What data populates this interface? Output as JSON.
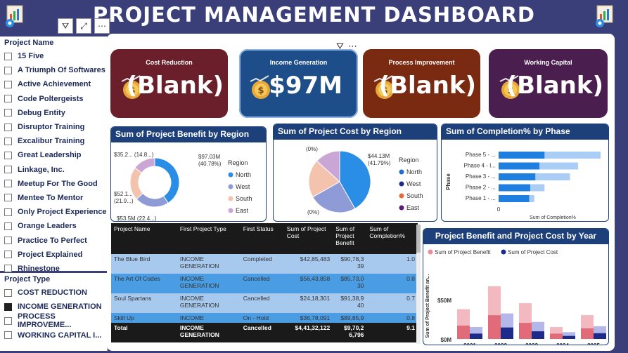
{
  "title": "PROJECT MANAGEMENT DASHBOARD",
  "project_name_slicer": {
    "header": "Project Name",
    "items": [
      "15 Five",
      "A Triumph Of Softwares",
      "Active Achievement",
      "Code Poltergeists",
      "Debug Entity",
      "Disruptor Training",
      "Excalibur Training",
      "Great Leadership",
      "Linkage, Inc.",
      "Meetup For The Good",
      "Mentee To Mentor",
      "Only Project Experience",
      "Orange Leaders",
      "Practice To Perfect",
      "Project Explained",
      "Rhinestone"
    ]
  },
  "project_type_slicer": {
    "header": "Project Type",
    "items": [
      "COST REDUCTION",
      "INCOME GENERATION",
      "PROCESS IMPROVEME...",
      "WORKING CAPITAL I..."
    ],
    "selected_index": 1
  },
  "cards": [
    {
      "label": "Cost Reduction",
      "value": "(Blank)",
      "color": "#6b1f2a",
      "icon": "money-bag-chart-icon"
    },
    {
      "label": "Income Generation",
      "value": "$97M",
      "color": "#1e4e8a",
      "icon": "money-hand-icon"
    },
    {
      "label": "Process Improvement",
      "value": "(Blank)",
      "color": "#7a2a10",
      "icon": "gear-growth-icon"
    },
    {
      "label": "Working Capital",
      "value": "(Blank)",
      "color": "#4a1e4e",
      "icon": "coin-gear-icon"
    }
  ],
  "benefit_by_region": {
    "title": "Sum of Project Benefit by Region",
    "legend_title": "Region",
    "labels": [
      "$97.03M",
      "(40.78%)",
      "$35.2...",
      "(14.8...)",
      "$52.1...",
      "(21.9...)",
      "$53.5M (22.4...)"
    ],
    "chart_data": {
      "type": "pie",
      "categories": [
        "North",
        "West",
        "South",
        "East"
      ],
      "values": [
        40.78,
        22.4,
        21.9,
        14.8
      ],
      "colors": [
        "#2a8ee6",
        "#8e9bd6",
        "#f3c3ad",
        "#c9a6d6"
      ]
    }
  },
  "cost_by_region": {
    "title": "Sum of Project Cost by Region",
    "legend_title": "Region",
    "labels": [
      "$44.13M",
      "(41.79%)",
      "(0%)",
      "(0%)"
    ],
    "chart_data": {
      "type": "pie",
      "categories": [
        "North",
        "West",
        "South",
        "East"
      ],
      "values": [
        41.79,
        25,
        20,
        13.21
      ],
      "colors": [
        "#2a8ee6",
        "#8e9bd6",
        "#f3c3ad",
        "#c9a6d6"
      ],
      "legend_colors": [
        "#1f6fd1",
        "#1e2a8a",
        "#e06a3a",
        "#5a1a7a"
      ]
    }
  },
  "completion_by_phase": {
    "title": "Sum of Completion% by Phase",
    "y_axis": "Phase",
    "x_axis": "Sum of Completion%",
    "x_tick": "0",
    "chart_data": {
      "type": "bar",
      "categories": [
        "Phase 5 - ...",
        "Phase 4 - I...",
        "Phase 3 - ...",
        "Phase 2 - ...",
        "Phase 1 - ..."
      ],
      "series": [
        {
          "values": [
            4.5,
            4.0,
            3.6,
            3.1,
            3.0
          ]
        },
        {
          "values": [
            10.0,
            7.8,
            7.0,
            4.5,
            3.5
          ]
        }
      ]
    }
  },
  "table": {
    "headers": [
      "Project Name",
      "First Project Type",
      "First Status",
      "Sum of Project Cost",
      "Sum of Project Benefit",
      "Sum of Completion%"
    ],
    "rows": [
      [
        "The Blue Bird",
        "INCOME GENERATION",
        "Completed",
        "$42,85,483",
        "$90,78,3 39",
        "1.0"
      ],
      [
        "The Art Of Codes",
        "INCOME GENERATION",
        "Cancelled",
        "$56,43,858",
        "$85,73,0 30",
        "0.8"
      ],
      [
        "Soul Spartans",
        "INCOME GENERATION",
        "Cancelled",
        "$24,18,301",
        "$91,38,9 40",
        "0.7"
      ],
      [
        "Skill Up",
        "INCOME",
        "On - Hold",
        "$36,78,091",
        "$89,85,9",
        "0.8"
      ]
    ],
    "total": [
      "Total",
      "INCOME GENERATION",
      "Cancelled",
      "$4,41,32,122",
      "$9,70,2 6,796",
      "9.1"
    ]
  },
  "benefit_cost_year": {
    "title": "Project Benefit and Project Cost by Year",
    "legend": [
      "Sum of  Project Benefit",
      "Sum of  Project Cost"
    ],
    "y_axis": "Sum of Project Benefit an...",
    "x_axis": "Project Benefit",
    "y_ticks": [
      "$50M",
      "$0M"
    ],
    "chart_data": {
      "type": "bar",
      "categories": [
        "2021",
        "2022",
        "2023",
        "2024",
        "2025"
      ],
      "series": [
        {
          "name": "Sum of  Project Benefit",
          "values": [
            35,
            62,
            42,
            14,
            28
          ]
        },
        {
          "name": "Sum of  Project Cost",
          "values": [
            14,
            30,
            20,
            8,
            15
          ]
        }
      ],
      "ylim": [
        0,
        80
      ]
    }
  }
}
